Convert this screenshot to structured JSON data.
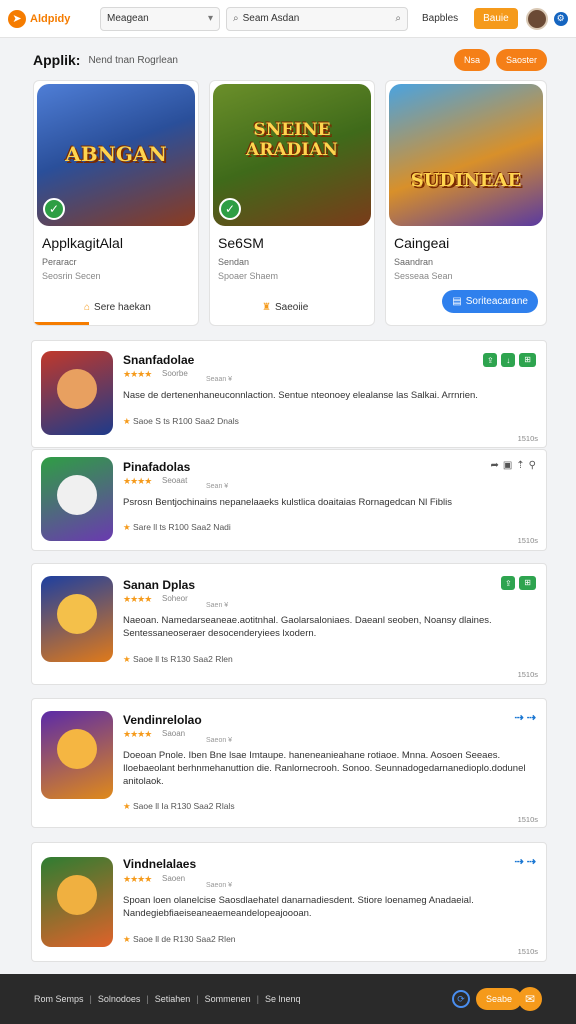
{
  "topbar": {
    "logo": "Aldpidy",
    "select_value": "Meagean",
    "search_value": "Seam Asdan",
    "nav_label": "Bapbles",
    "signin_label": "Bauie"
  },
  "page": {
    "title": "Applik:",
    "subtitle": "Nend tnan Rogrlean",
    "btn1": "Nsa",
    "btn2": "Saoster"
  },
  "cards": [
    {
      "art_text": "ABNGAN",
      "title": "ApplkagitAlal",
      "meta1": "Peraracr",
      "meta2": "Seosrin Secen",
      "action": "Sere haekan",
      "colors": [
        "#4f7ed6",
        "#8b3b20"
      ]
    },
    {
      "art_text": "SNEINE ARADIAN",
      "title": "Se6SM",
      "meta1": "Sendan",
      "meta2": "Spoaer Shaem",
      "action": "Saeoiie",
      "colors": [
        "#6b8f2a",
        "#7a3b1a"
      ]
    },
    {
      "art_text": "SUDINEAE",
      "title": "Caingeai",
      "meta1": "Saandran",
      "meta2": "Sesseaa Sean",
      "action": "Soriteacarane",
      "colors": [
        "#d8902a",
        "#5a3aa0"
      ]
    }
  ],
  "items": [
    {
      "title": "Snanfadolae",
      "rating": "Soorbe",
      "mini": "Seaan ¥",
      "desc": "Nase de dertenenhaneuconnlaction. Sentue nteonoey elealanse las Salkai. Arrnrien.",
      "meta": "Saoe   S   ts   R100   Saa2   Dnals",
      "stamp": "1510s",
      "colors": [
        "#c0392b",
        "#1e3a8a"
      ],
      "face": "#e8a060"
    },
    {
      "title": "Pinafadolas",
      "rating": "Seoaat",
      "mini": "Sean ¥",
      "desc": "Psrosn Bentjochinains nepanelaaeks kulstlica doaitaias Rornagedcan  Nl Fiblis",
      "meta": "Sare   ll   ts   R100   Saa2   Nadi",
      "stamp": "1510s",
      "colors": [
        "#2f9e44",
        "#6a3ab0"
      ],
      "face": "#f0f0f0"
    },
    {
      "title": "Sanan Dplas",
      "rating": "Soheor",
      "mini": "Saen ¥",
      "desc": "Naeoan. Namedarseaneae.aotitnhal. Gaolarsaloniaes. Daeanl seoben, Noansy dlaines. Sentessaneoseraer desocenderyiees lxodern.",
      "meta": "Saoe   ll   ts   R130   Saa2   Rlen",
      "stamp": "1510s",
      "colors": [
        "#1d3fa0",
        "#e07a1a"
      ],
      "face": "#f4c04a"
    },
    {
      "title": "Vendinrelolao",
      "rating": "Saoan",
      "mini": "Saeon ¥",
      "desc": "Doeoan Pnole. Iben Bne lsae Imtaupe. haneneanieahane rotiaoe. Mnna. Aosoen Seeaes. Iloebaeolant berhnmehanuttion die. Ranlornecrooh. Sonoo. Seunnadogedarnanedioplo.dodunel anitolaok.",
      "meta": "Saoe   ll   Ia   R130   Saa2   Rlals",
      "stamp": "1510s",
      "colors": [
        "#5b2aa8",
        "#e08a1a"
      ],
      "face": "#f5b642"
    },
    {
      "title": "Vindnelalaes",
      "rating": "Saoen",
      "mini": "Saeon ¥",
      "desc": "Spoan loen olanelcise Saosdlaehatel danarnadiesdent. Stiore loenameg Anadaeial. Nandegiebfiaeiseaneaemeandelopeajoooan.",
      "meta": "Saoe   ll   de   R130   Saa2   Rlen",
      "stamp": "1510s",
      "colors": [
        "#2e7d32",
        "#e0622a"
      ],
      "face": "#f0b040"
    }
  ],
  "footer": {
    "links": [
      "Rom Semps",
      "Solnodoes",
      "Setiahen",
      "Sommenen",
      "Se lnenq"
    ],
    "cta": "Seabe"
  }
}
